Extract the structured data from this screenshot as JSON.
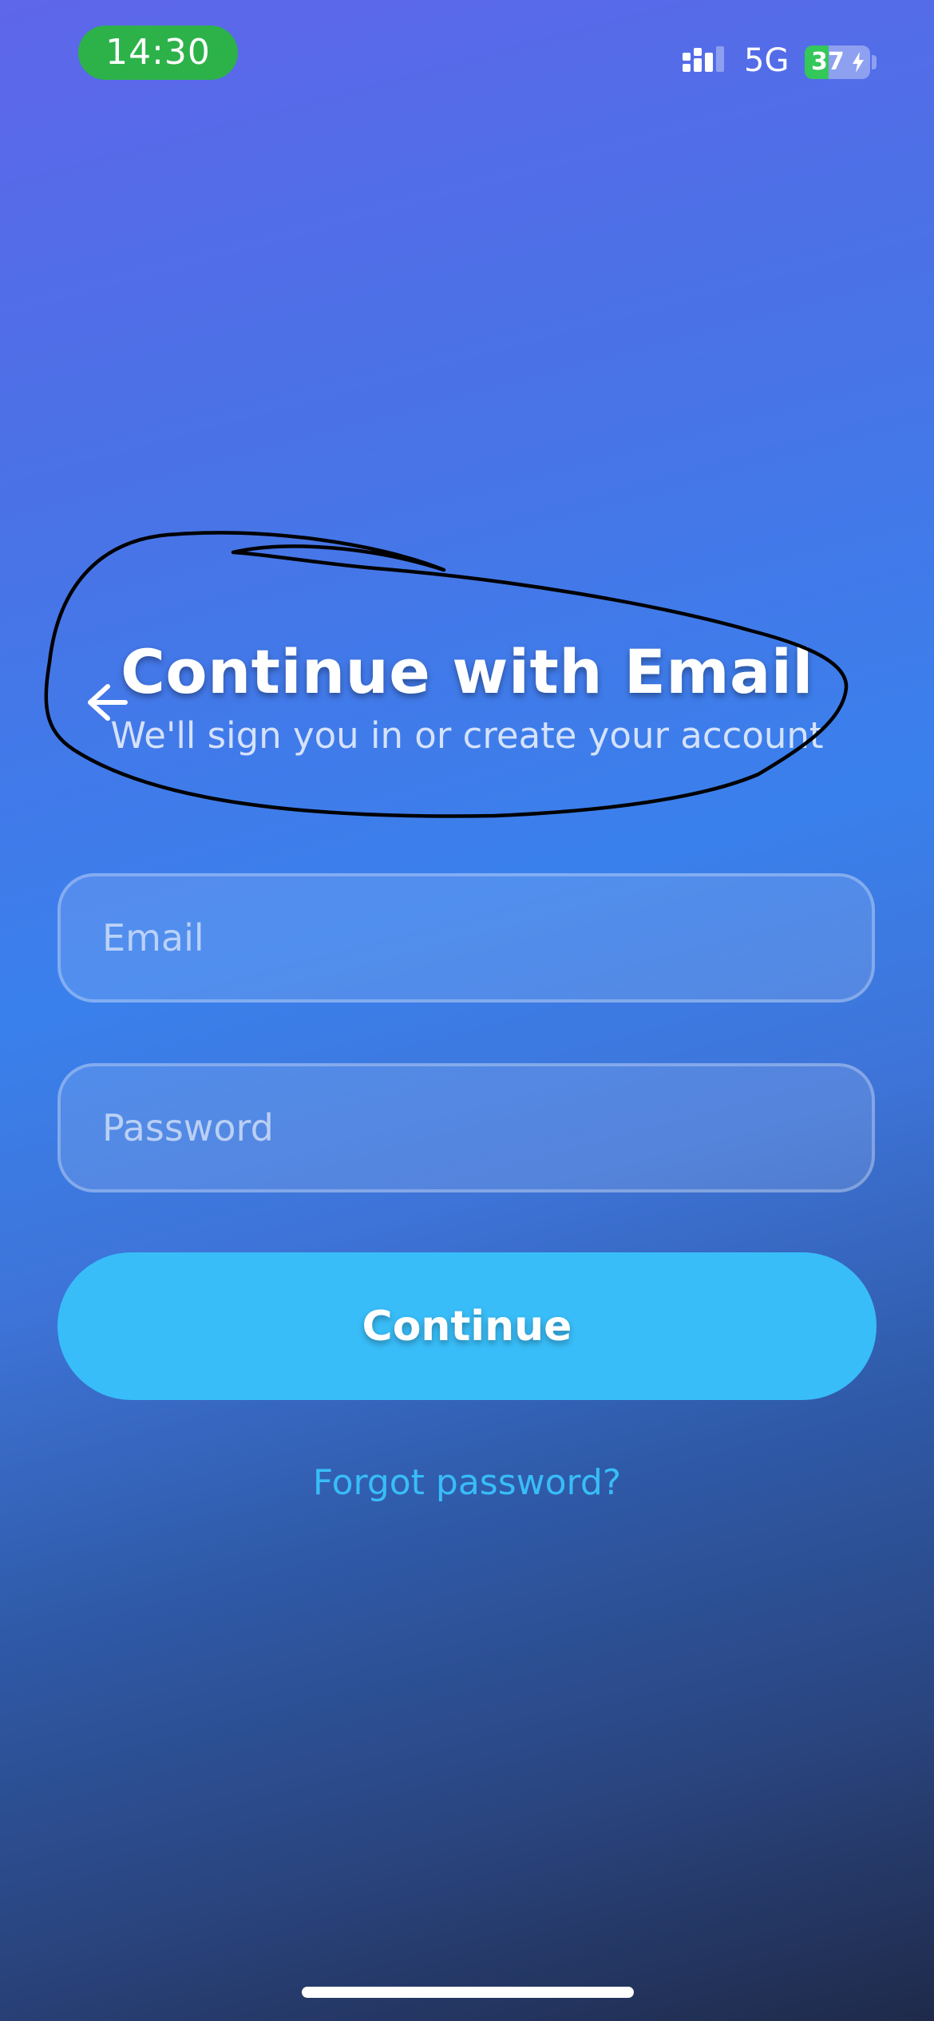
{
  "status_bar": {
    "time": "14:30",
    "network": "5G",
    "battery_level": "37",
    "battery_fraction": 0.37,
    "charging": true,
    "signal_icon": "cellular-signal-icon",
    "charging_icon": "lightning-bolt-icon"
  },
  "header": {
    "back_icon": "arrow-left-icon",
    "title": "Continue with Email",
    "subtitle": "We'll sign you in or create your account"
  },
  "form": {
    "email": {
      "value": "",
      "placeholder": "Email"
    },
    "password": {
      "value": "",
      "placeholder": "Password"
    },
    "submit_label": "Continue",
    "forgot_password": "Forgot password?"
  },
  "colors": {
    "accent": "#38bdf8",
    "time_pill": "#2db24a",
    "battery_fill": "#34c759",
    "text": "#ffffff",
    "background_top": "#5e66ea",
    "background_bottom": "#1f2a4a",
    "annotation_stroke": "#000000"
  }
}
